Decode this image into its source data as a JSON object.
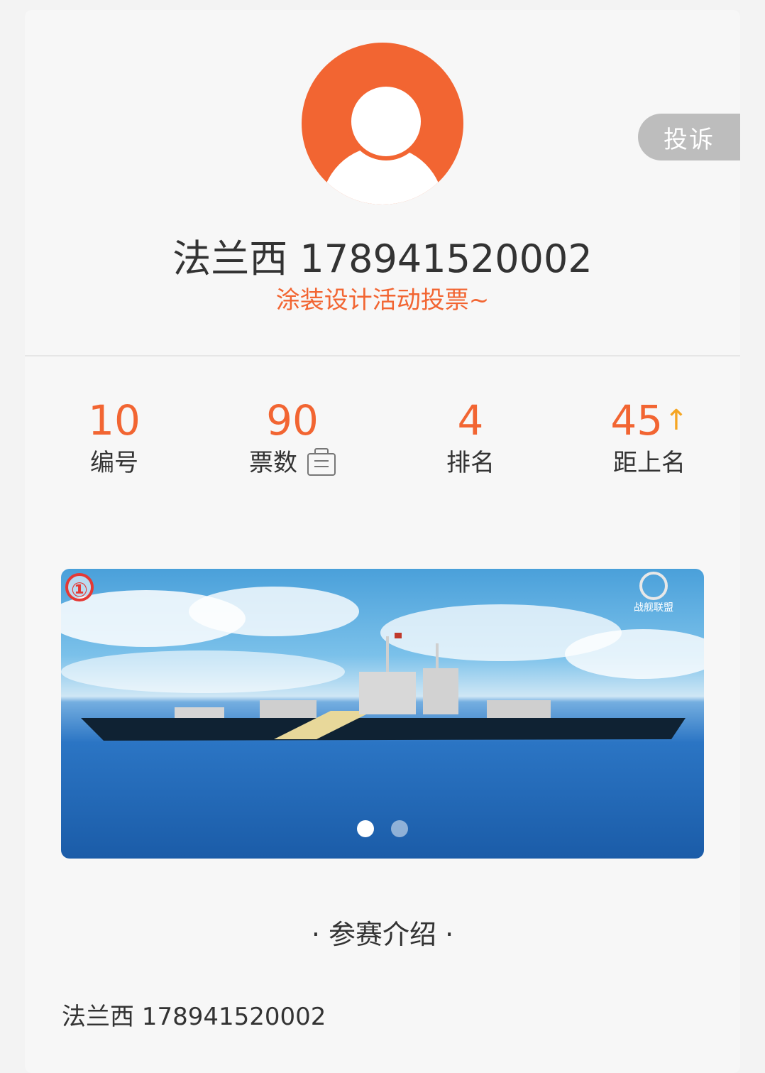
{
  "header": {
    "report_label": "投诉",
    "title": "法兰西 178941520002",
    "subtitle": "涂装设计活动投票~"
  },
  "stats": [
    {
      "value": "10",
      "label": "编号"
    },
    {
      "value": "90",
      "label": "票数"
    },
    {
      "value": "4",
      "label": "排名"
    },
    {
      "value": "45",
      "label": "距上名"
    }
  ],
  "banner": {
    "badge": "①",
    "logo_text": "战舰联盟",
    "slide_count": 2,
    "active_slide": 1
  },
  "section": {
    "title": "· 参赛介绍 ·",
    "intro_text": "法兰西 178941520002"
  },
  "colors": {
    "accent": "#f26532",
    "arrow": "#f5a623"
  },
  "icons": {
    "avatar": "user-avatar-icon",
    "votes": "ticket-icon",
    "trend": "arrow-up-icon"
  }
}
